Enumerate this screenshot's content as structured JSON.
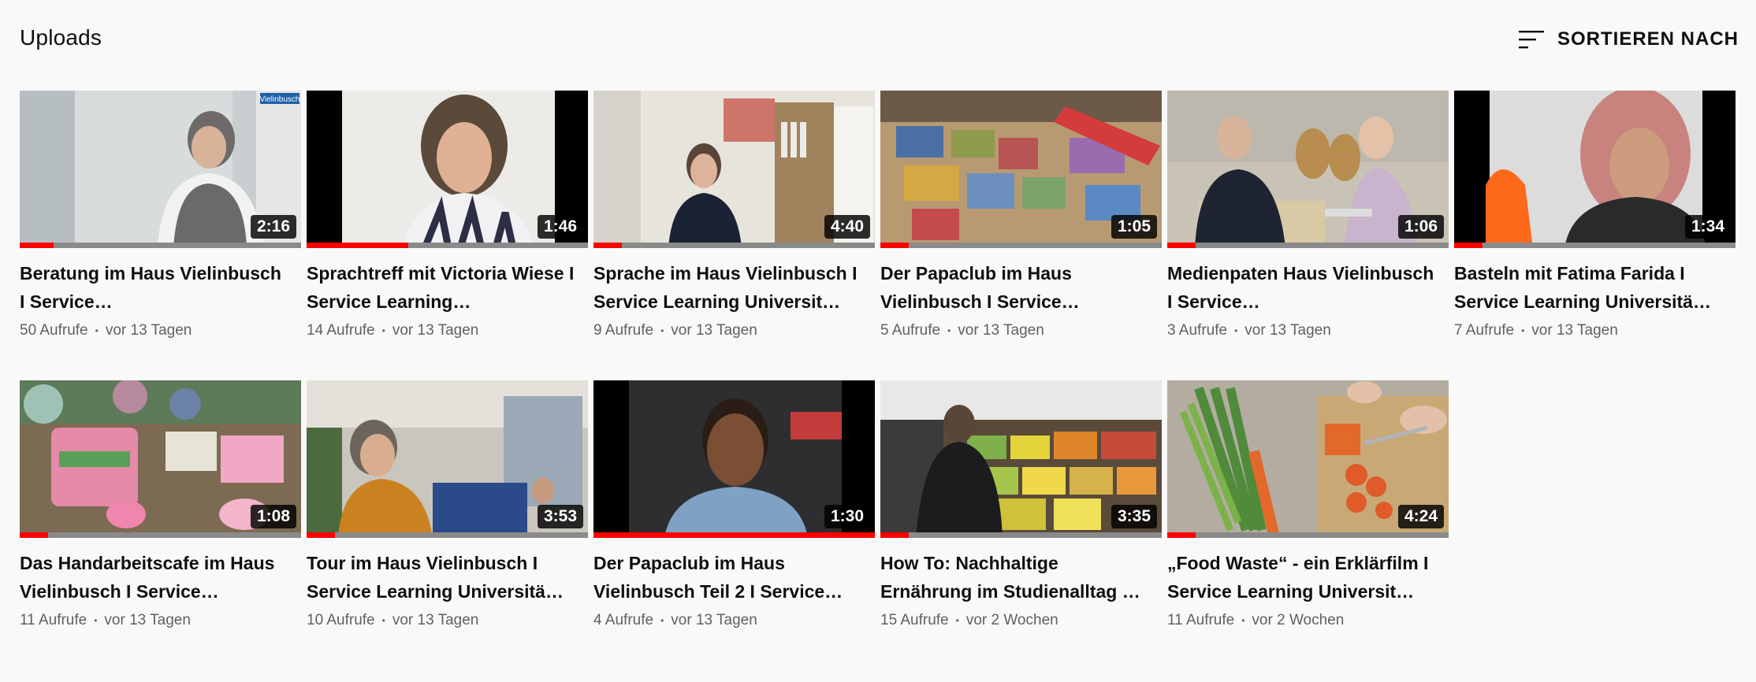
{
  "section": {
    "title": "Uploads",
    "sort_label": "SORTIEREN NACH",
    "sort_icon": "sort-icon"
  },
  "colors": {
    "progress": "#ff0000",
    "background": "#f9f9f9",
    "meta_text": "#606060"
  },
  "videos": [
    {
      "title": "Beratung im Haus Vielinbusch I Service…",
      "views": "50 Aufrufe",
      "age": "vor 13 Tagen",
      "duration": "2:16",
      "watched": 0.12,
      "badge": "Vielinbusch"
    },
    {
      "title": "Sprachtreff mit Victoria Wiese I Service Learning…",
      "views": "14 Aufrufe",
      "age": "vor 13 Tagen",
      "duration": "1:46",
      "watched": 0.36
    },
    {
      "title": "Sprache im Haus Vielinbusch I Service Learning Universit…",
      "views": "9 Aufrufe",
      "age": "vor 13 Tagen",
      "duration": "4:40",
      "watched": 0.1
    },
    {
      "title": "Der Papaclub im Haus Vielinbusch I Service…",
      "views": "5 Aufrufe",
      "age": "vor 13 Tagen",
      "duration": "1:05",
      "watched": 0.1
    },
    {
      "title": "Medienpaten Haus Vielinbusch I Service…",
      "views": "3 Aufrufe",
      "age": "vor 13 Tagen",
      "duration": "1:06",
      "watched": 0.1
    },
    {
      "title": "Basteln mit Fatima Farida I Service Learning Universitä…",
      "views": "7 Aufrufe",
      "age": "vor 13 Tagen",
      "duration": "1:34",
      "watched": 0.1
    },
    {
      "title": "Das Handarbeitscafe im Haus Vielinbusch I Service…",
      "views": "11 Aufrufe",
      "age": "vor 13 Tagen",
      "duration": "1:08",
      "watched": 0.1
    },
    {
      "title": "Tour im Haus Vielinbusch I Service Learning Universitä…",
      "views": "10 Aufrufe",
      "age": "vor 13 Tagen",
      "duration": "3:53",
      "watched": 0.1
    },
    {
      "title": "Der Papaclub im Haus Vielinbusch Teil 2 I Service…",
      "views": "4 Aufrufe",
      "age": "vor 13 Tagen",
      "duration": "1:30",
      "watched": 1.0
    },
    {
      "title": "How To: Nachhaltige Ernährung im Studienalltag …",
      "views": "15 Aufrufe",
      "age": "vor 2 Wochen",
      "duration": "3:35",
      "watched": 0.1
    },
    {
      "title": "„Food Waste“ - ein Erklärfilm I Service Learning Universit…",
      "views": "11 Aufrufe",
      "age": "vor 2 Wochen",
      "duration": "4:24",
      "watched": 0.1
    }
  ]
}
